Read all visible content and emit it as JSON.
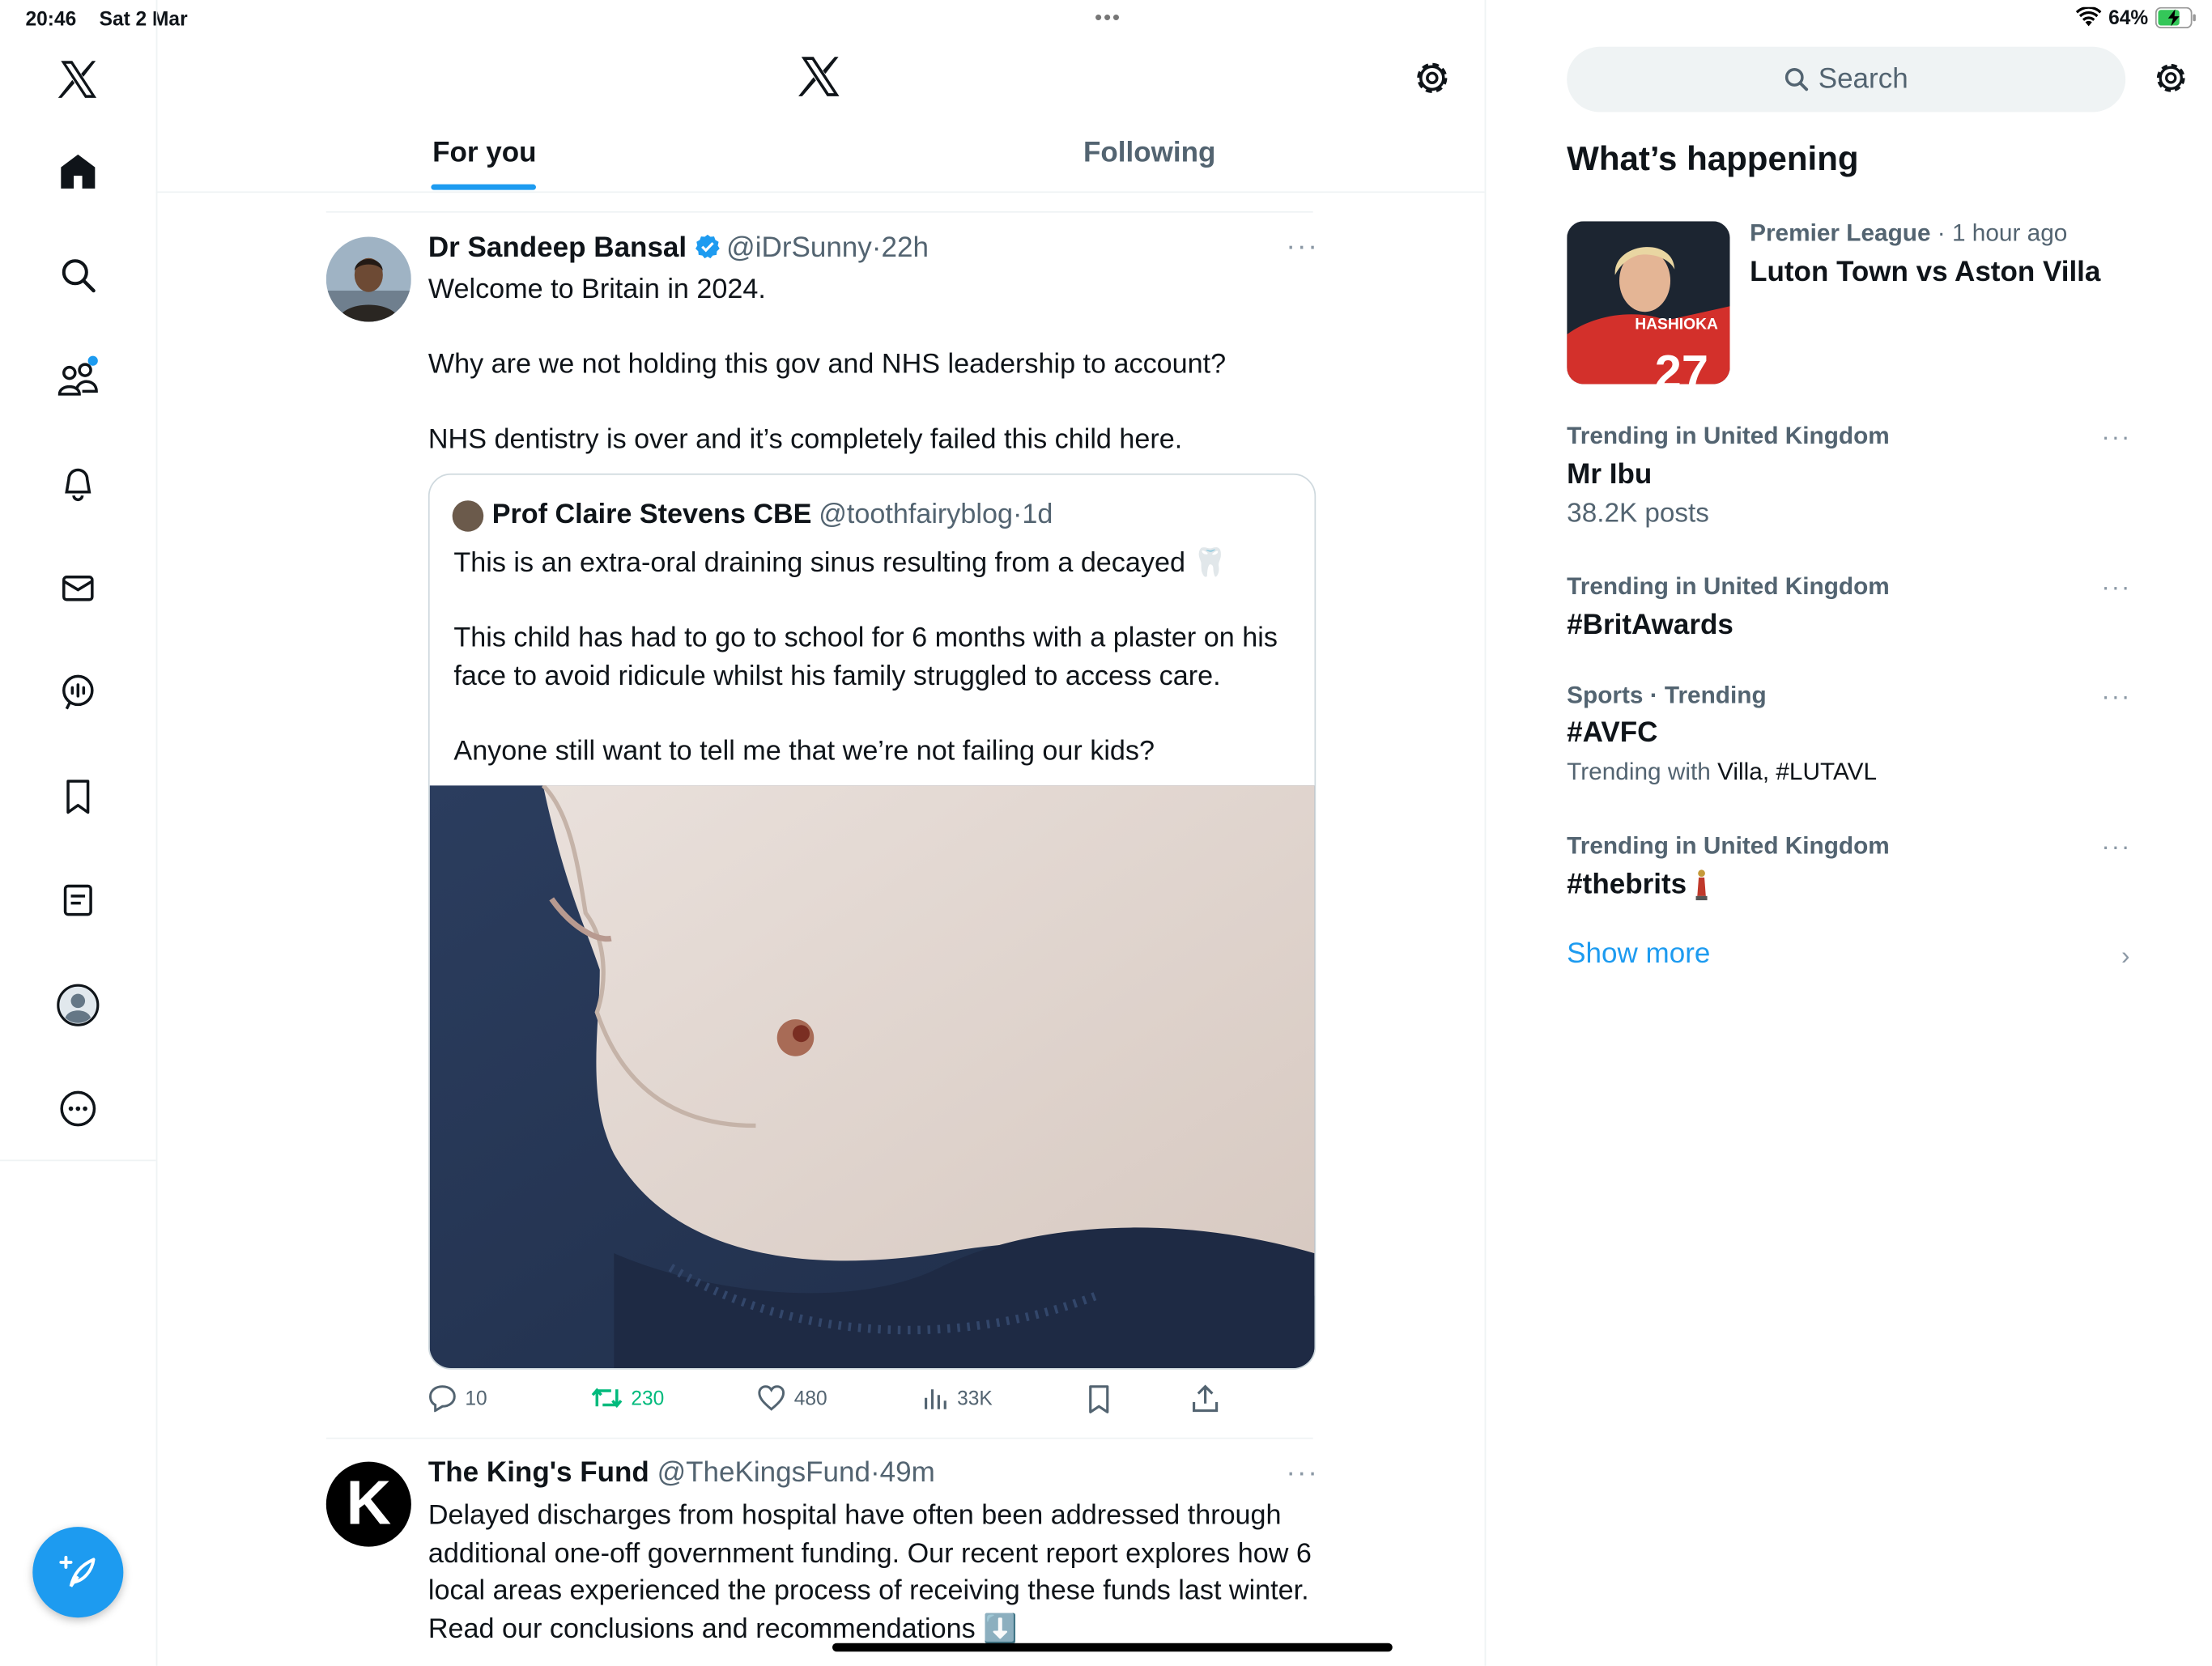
{
  "status_bar": {
    "time": "20:46",
    "date": "Sat 2 Mar",
    "battery": "64%"
  },
  "header": {
    "tabs": [
      "For you",
      "Following"
    ]
  },
  "tweets": [
    {
      "name": "Dr Sandeep Bansal",
      "handle": "@iDrSunny",
      "time": "22h",
      "paragraphs": [
        "Welcome to Britain in 2024.",
        "Why are we not holding this gov and NHS leadership to account?",
        "NHS dentistry is over and it’s completely failed this child here."
      ],
      "quote": {
        "name": "Prof Claire Stevens CBE",
        "handle": "@toothfairyblog",
        "time": "1d",
        "paragraphs": [
          "This is an extra-oral draining sinus resulting from a decayed 🦷",
          "This child has had to go to school for 6 months with a plaster on his face to avoid ridicule whilst his family struggled to access care.",
          "Anyone still want to tell me that we’re not failing our kids?"
        ]
      },
      "stats": {
        "replies": "10",
        "retweets": "230",
        "likes": "480",
        "views": "33K"
      }
    },
    {
      "name": "The King's Fund",
      "handle": "@TheKingsFund",
      "time": "49m",
      "avatar_letter": "K",
      "text": "Delayed discharges from hospital have often been addressed through additional one-off government funding. Our recent report explores how 6 local areas experienced the process of receiving these funds last winter. Read our conclusions and recommendations ⬇️"
    }
  ],
  "sidebar": {
    "search_placeholder": "Search",
    "title": "What’s happening",
    "jersey_name": "HASHIOKA",
    "trends": [
      {
        "category": "Premier League",
        "time": "1 hour ago",
        "name": "Luton Town vs Aston Villa"
      },
      {
        "category": "Trending in United Kingdom",
        "name": "Mr Ibu",
        "count": "38.2K posts"
      },
      {
        "category": "Trending in United Kingdom",
        "name": "#BritAwards"
      },
      {
        "category": "Sports · Trending",
        "name": "#AVFC",
        "with_prefix": "Trending with",
        "with_terms": "Villa, #LUTAVL"
      },
      {
        "category": "Trending in United Kingdom",
        "name": "#thebrits"
      }
    ],
    "show_more": "Show more"
  },
  "colors": {
    "accent": "#1d9bf0",
    "retweet_green": "#00ba7c",
    "secondary_text": "#536471"
  },
  "icons": [
    "x-logo-icon",
    "home-icon",
    "search-icon",
    "communities-icon",
    "bell-icon",
    "mail-icon",
    "spaces-icon",
    "bookmark-icon",
    "lists-icon",
    "profile-icon",
    "more-icon",
    "compose-icon",
    "gear-icon",
    "reply-icon",
    "retweet-icon",
    "like-icon",
    "views-icon",
    "share-icon",
    "wifi-icon",
    "battery-icon"
  ]
}
